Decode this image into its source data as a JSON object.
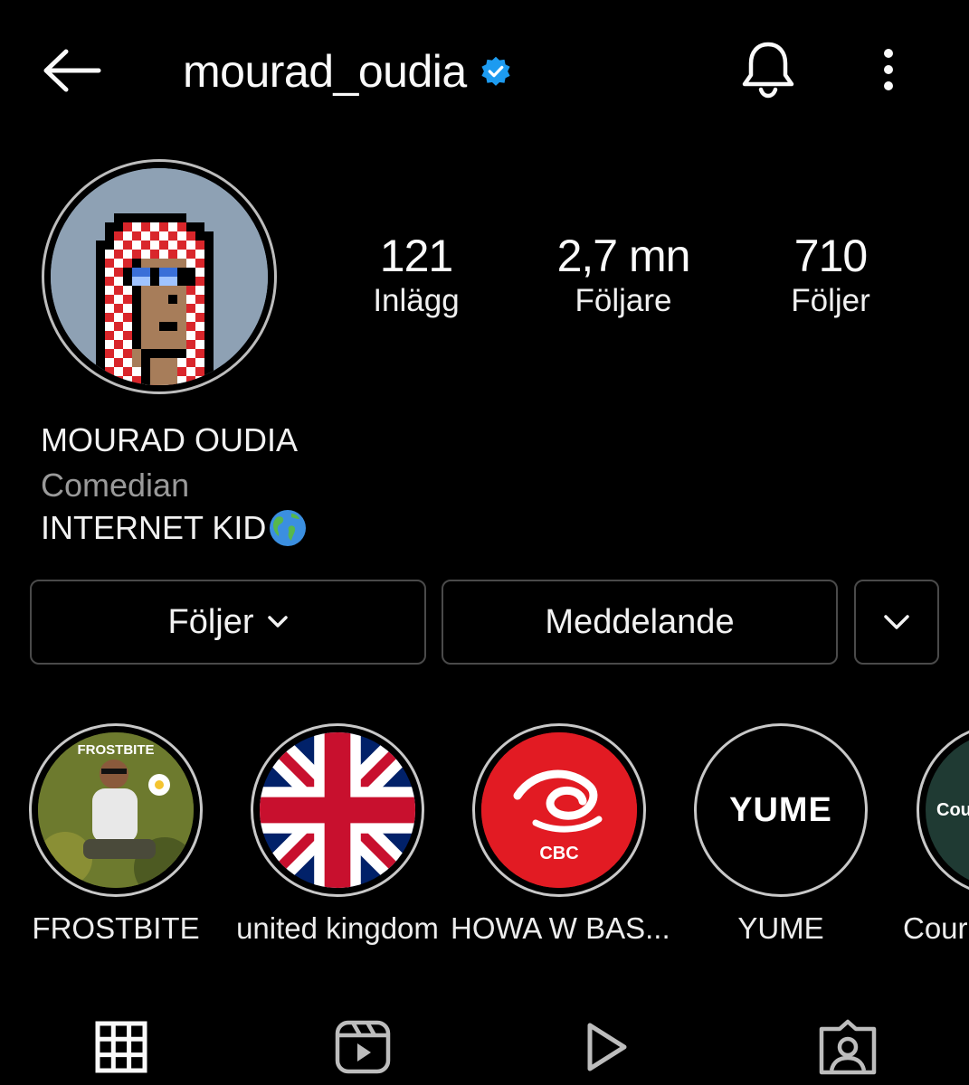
{
  "header": {
    "username": "mourad_oudia",
    "verified": true,
    "back_icon": "arrow-left-icon",
    "bell_icon": "bell-icon",
    "more_icon": "more-vertical-icon"
  },
  "stats": [
    {
      "value": "121",
      "label": "Inlägg"
    },
    {
      "value": "2,7 mn",
      "label": "Följare"
    },
    {
      "value": "710",
      "label": "Följer"
    }
  ],
  "bio": {
    "name": "MOURAD OUDIA",
    "category": "Comedian",
    "text": "INTERNET KID"
  },
  "actions": {
    "follow_label": "Följer",
    "message_label": "Meddelande"
  },
  "highlights": [
    {
      "label": "FROSTBITE",
      "cover_text": "FROSTBITE"
    },
    {
      "label": "united kingdom"
    },
    {
      "label": "HOWA W BAS...",
      "cover_text": "CBC"
    },
    {
      "label": "YUME",
      "cover_text": "YUME"
    },
    {
      "label": "Cour",
      "cover_text": "Cou"
    }
  ],
  "tabs": [
    "grid-icon",
    "reels-icon",
    "play-icon",
    "tagged-icon"
  ],
  "colors": {
    "background": "#000000",
    "verified_blue": "#1d9bf0",
    "muted_text": "#9a9a9a",
    "button_border": "#4a4a4a"
  }
}
